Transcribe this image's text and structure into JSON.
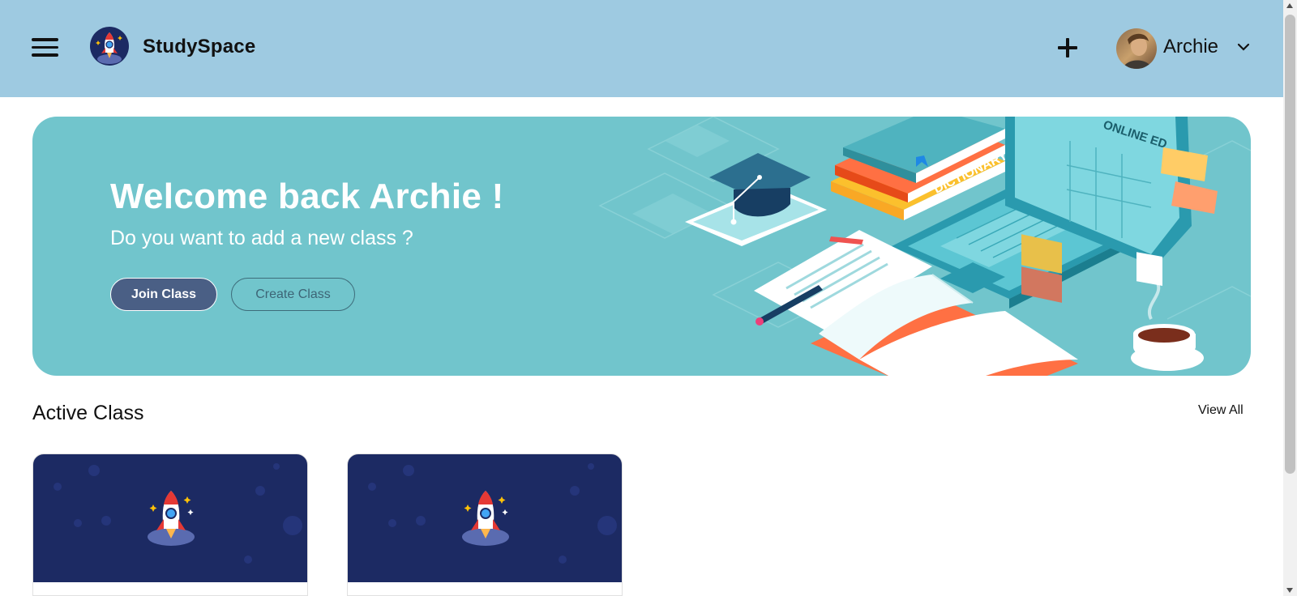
{
  "header": {
    "brand": "StudySpace",
    "user_name": "Archie",
    "icons": {
      "menu": "hamburger-menu-icon",
      "logo": "rocket-logo-icon",
      "add": "plus-icon",
      "dropdown": "chevron-down-icon"
    }
  },
  "banner": {
    "welcome_text": "Welcome back Archie !",
    "subtitle": "Do you want to add a new class ?",
    "join_button": "Join Class",
    "create_button": "Create Class",
    "illustration_text": {
      "dictionary": "DICTIONARY",
      "online": "ONLINE ED"
    }
  },
  "active_class": {
    "title": "Active Class",
    "view_all": "View All",
    "cards": [
      {
        "icon": "rocket-icon"
      },
      {
        "icon": "rocket-icon"
      }
    ]
  },
  "colors": {
    "header_bg": "#9ecae1",
    "banner_bg": "#71c5cc",
    "join_button_bg": "#4a5f85",
    "card_bg": "#1c2a63"
  }
}
